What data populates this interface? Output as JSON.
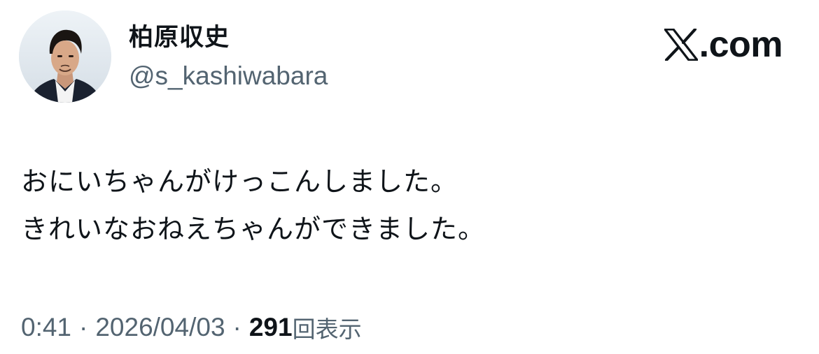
{
  "author": {
    "display_name": "柏原収史",
    "handle": "@s_kashiwabara",
    "avatar_icon": "profile-photo-icon"
  },
  "brand": {
    "icon": "x-logo-icon",
    "label": ".com"
  },
  "tweet": {
    "lines": [
      "おにいちゃんがけっこんしました。",
      "きれいなおねえちゃんができました。"
    ]
  },
  "meta": {
    "time": "0:41",
    "separator": "·",
    "date": "2026/04/03",
    "views_count": "291",
    "views_label": "回表示"
  },
  "colors": {
    "text_primary": "#0f1419",
    "text_secondary": "#536471",
    "background": "#ffffff"
  }
}
